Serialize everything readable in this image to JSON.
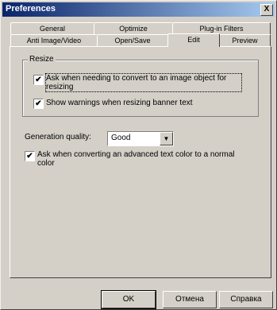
{
  "window": {
    "title": "Preferences",
    "close_label": "X"
  },
  "tabs_row1": [
    {
      "label": "General"
    },
    {
      "label": "Optimize"
    },
    {
      "label": "Plug-in Filters"
    }
  ],
  "tabs_row2": [
    {
      "label": "Anti Image/Video"
    },
    {
      "label": "Open/Save"
    },
    {
      "label": "Edit"
    },
    {
      "label": "Preview"
    }
  ],
  "active_tab": "Edit",
  "resize_group": {
    "label": "Resize",
    "options": [
      {
        "label": "Ask when needing to convert to an image object for resizing",
        "checked": true
      },
      {
        "label": "Show warnings when resizing banner text",
        "checked": true
      }
    ]
  },
  "generation_quality": {
    "label": "Generation quality:",
    "value": "Good"
  },
  "advanced_text_option": {
    "label": "Ask when converting an advanced text color to a normal color",
    "checked": true
  },
  "buttons": {
    "ok": "OK",
    "cancel": "Отмена",
    "help": "Справка"
  }
}
